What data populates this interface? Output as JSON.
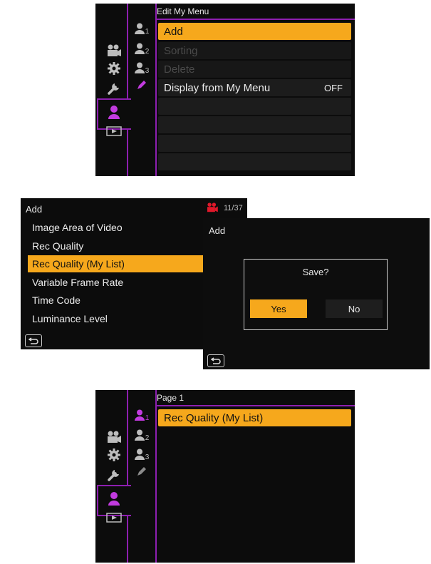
{
  "screen1": {
    "title": "Edit My Menu",
    "tabs": [
      {
        "icon": "user-icon",
        "num": "1"
      },
      {
        "icon": "user-icon",
        "num": "2"
      },
      {
        "icon": "user-icon",
        "num": "3"
      },
      {
        "icon": "pencil-icon"
      }
    ],
    "side_icons": [
      "video-camera-icon",
      "gear-icon",
      "wrench-icon",
      "person-icon",
      "play-icon"
    ],
    "items": [
      {
        "label": "Add",
        "state": "selected"
      },
      {
        "label": "Sorting",
        "state": "disabled"
      },
      {
        "label": "Delete",
        "state": "disabled"
      },
      {
        "label": "Display from My Menu",
        "value": "OFF",
        "state": "normal"
      }
    ]
  },
  "screen2": {
    "title": "Add",
    "page_indicator": "11/37",
    "items": [
      "Image Area of Video",
      "Rec Quality",
      "Rec Quality (My List)",
      "Variable Frame Rate",
      "Time Code",
      "Luminance Level"
    ],
    "selected_index": 2
  },
  "screen3": {
    "title": "Add",
    "dialog": {
      "question": "Save?",
      "yes": "Yes",
      "no": "No"
    }
  },
  "screen4": {
    "title": "Page 1",
    "tabs": [
      {
        "icon": "user-icon",
        "num": "1"
      },
      {
        "icon": "user-icon",
        "num": "2"
      },
      {
        "icon": "user-icon",
        "num": "3"
      },
      {
        "icon": "pencil-icon"
      }
    ],
    "items": [
      {
        "label": "Rec Quality (My List)",
        "state": "selected"
      }
    ]
  },
  "colors": {
    "accent": "#f6a81c",
    "purple": "#8d1fb0",
    "red": "#e0182a"
  }
}
